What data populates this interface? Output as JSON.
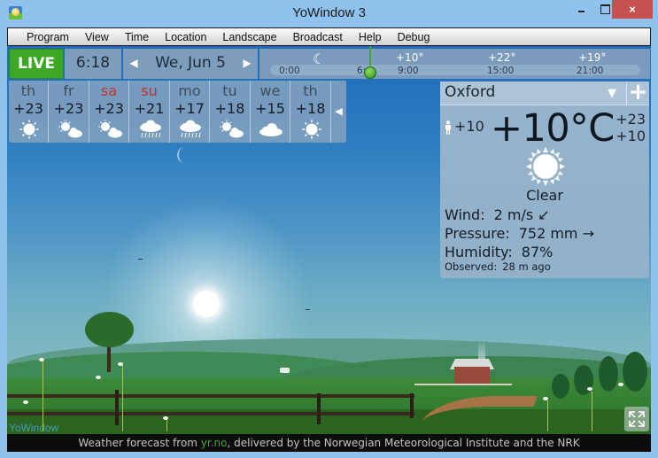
{
  "window": {
    "title": "YoWindow 3",
    "app_icon": "yowindow-sun-icon",
    "controls": {
      "minimize": "minimize-icon",
      "maximize": "maximize-icon",
      "close": "×"
    }
  },
  "menu": {
    "items": [
      {
        "label": "Program"
      },
      {
        "label": "View"
      },
      {
        "label": "Time"
      },
      {
        "label": "Location"
      },
      {
        "label": "Landscape"
      },
      {
        "label": "Broadcast"
      },
      {
        "label": "Help"
      },
      {
        "label": "Debug"
      }
    ]
  },
  "topbar": {
    "live_label": "LIVE",
    "current_time": "6:18",
    "date": "We, Jun 5",
    "prev_icon": "◀",
    "next_icon": "▶",
    "timeline": {
      "now_fraction": 0.26,
      "moon_icon": "☾",
      "ticks": [
        {
          "time": "0:00",
          "temp": ""
        },
        {
          "time": "6:",
          "temp": ""
        },
        {
          "time": "9:00",
          "temp": "+10°"
        },
        {
          "time": "15:00",
          "temp": "+22°"
        },
        {
          "time": "21:00",
          "temp": "+19°"
        }
      ]
    }
  },
  "forecast": {
    "days": [
      {
        "name": "th",
        "temp": "+23",
        "icon": "sunny",
        "weekend": false
      },
      {
        "name": "fr",
        "temp": "+23",
        "icon": "partly-cloudy",
        "weekend": false
      },
      {
        "name": "sa",
        "temp": "+23",
        "icon": "partly-cloudy",
        "weekend": true
      },
      {
        "name": "su",
        "temp": "+21",
        "icon": "rain",
        "weekend": true
      },
      {
        "name": "mo",
        "temp": "+17",
        "icon": "rain",
        "weekend": false
      },
      {
        "name": "tu",
        "temp": "+18",
        "icon": "partly-cloudy",
        "weekend": false
      },
      {
        "name": "we",
        "temp": "+15",
        "icon": "cloudy",
        "weekend": false
      },
      {
        "name": "th",
        "temp": "+18",
        "icon": "sunny",
        "weekend": false
      }
    ],
    "scroll_icon": "◀"
  },
  "current": {
    "city": "Oxford",
    "dropdown_icon": "▼",
    "add_icon": "+",
    "feels_like": "+10",
    "temperature": "+10°C",
    "high": "+23",
    "low": "+10",
    "condition": "Clear",
    "wind_label": "Wind:",
    "wind_value": "2 m/s ↙",
    "pressure_label": "Pressure:",
    "pressure_value": "752 mm →",
    "humidity_label": "Humidity:",
    "humidity_value": "87%",
    "observed_label": "Observed:",
    "observed_value": "28 m ago"
  },
  "scene": {
    "watermark": "YoWindow"
  },
  "footer": {
    "prefix": "Weather forecast from ",
    "link": "yr.no",
    "suffix": ", delivered by the Norwegian Meteorological Institute and the NRK"
  },
  "colors": {
    "live_green": "#3ca826",
    "weekend_red": "#c0342e",
    "close_red": "#c75050",
    "titlebar_blue": "#8fc3ee"
  }
}
